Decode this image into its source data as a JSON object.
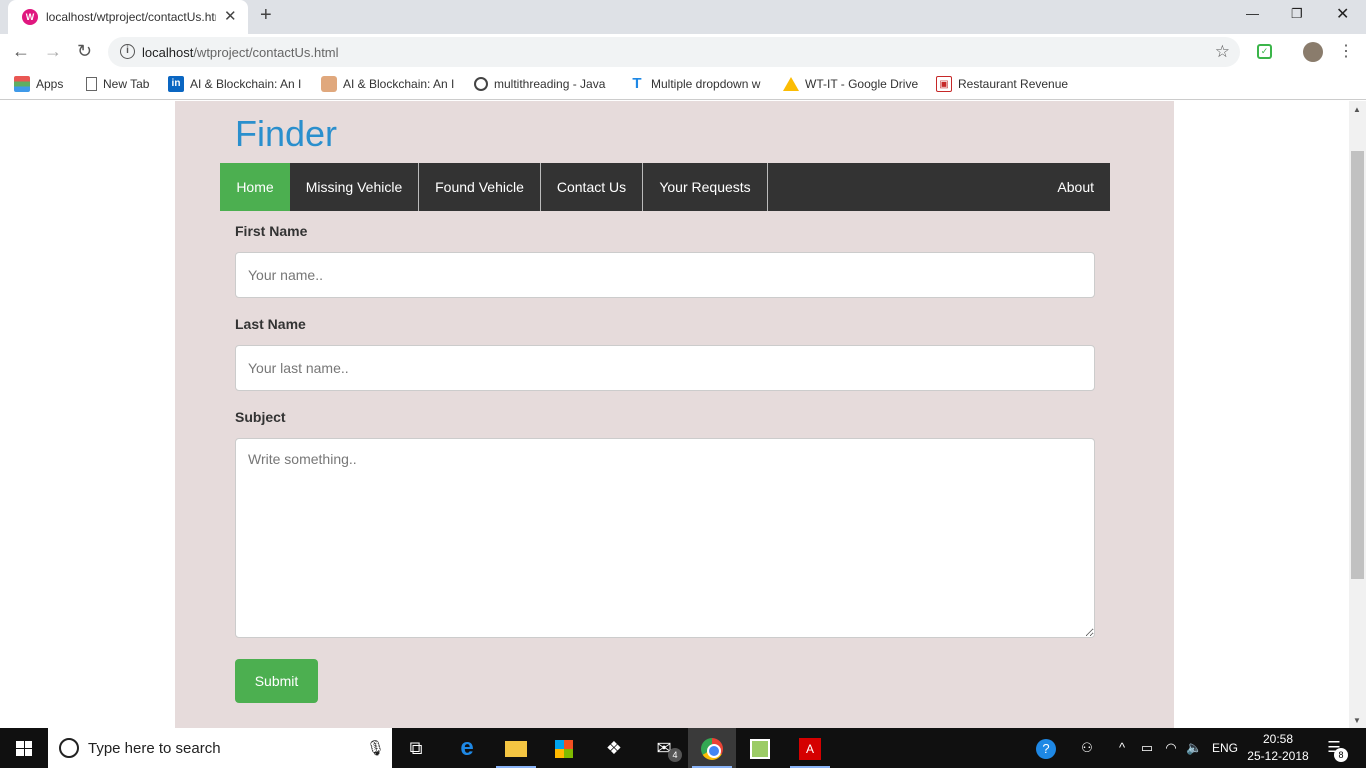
{
  "browser": {
    "tab": {
      "title": "localhost/wtproject/contactUs.html",
      "favicon_letter": "W"
    },
    "url": {
      "host": "localhost",
      "path": "/wtproject/contactUs.html"
    },
    "bookmarks": [
      {
        "label": "Apps",
        "icon": "apps-grid-icon"
      },
      {
        "label": "New Tab",
        "icon": "page-icon"
      },
      {
        "label": "AI & Blockchain: An I",
        "icon": "linkedin-icon"
      },
      {
        "label": "AI & Blockchain: An I",
        "icon": "face-icon"
      },
      {
        "label": "multithreading - Java",
        "icon": "globe-icon"
      },
      {
        "label": "Multiple dropdown w",
        "icon": "t-icon"
      },
      {
        "label": "WT-IT - Google Drive",
        "icon": "google-drive-icon"
      },
      {
        "label": "Restaurant Revenue P",
        "icon": "restaurant-icon"
      }
    ]
  },
  "page": {
    "brand": "Finder",
    "nav": [
      {
        "label": "Home",
        "active": true
      },
      {
        "label": "Missing Vehicle"
      },
      {
        "label": "Found Vehicle"
      },
      {
        "label": "Contact Us"
      },
      {
        "label": "Your Requests"
      },
      {
        "label": "About"
      }
    ],
    "form": {
      "first_name_label": "First Name",
      "first_name_placeholder": "Your name..",
      "last_name_label": "Last Name",
      "last_name_placeholder": "Your last name..",
      "subject_label": "Subject",
      "subject_placeholder": "Write something..",
      "submit_label": "Submit"
    },
    "colors": {
      "brand": "#2a8fcd",
      "accent": "#4caf50",
      "nav_bg": "#333333",
      "container_bg": "#e6dbdb"
    }
  },
  "taskbar": {
    "search_placeholder": "Type here to search",
    "mail_badge": "4",
    "language": "ENG",
    "time": "20:58",
    "date": "25-12-2018",
    "notification_count": "8"
  }
}
